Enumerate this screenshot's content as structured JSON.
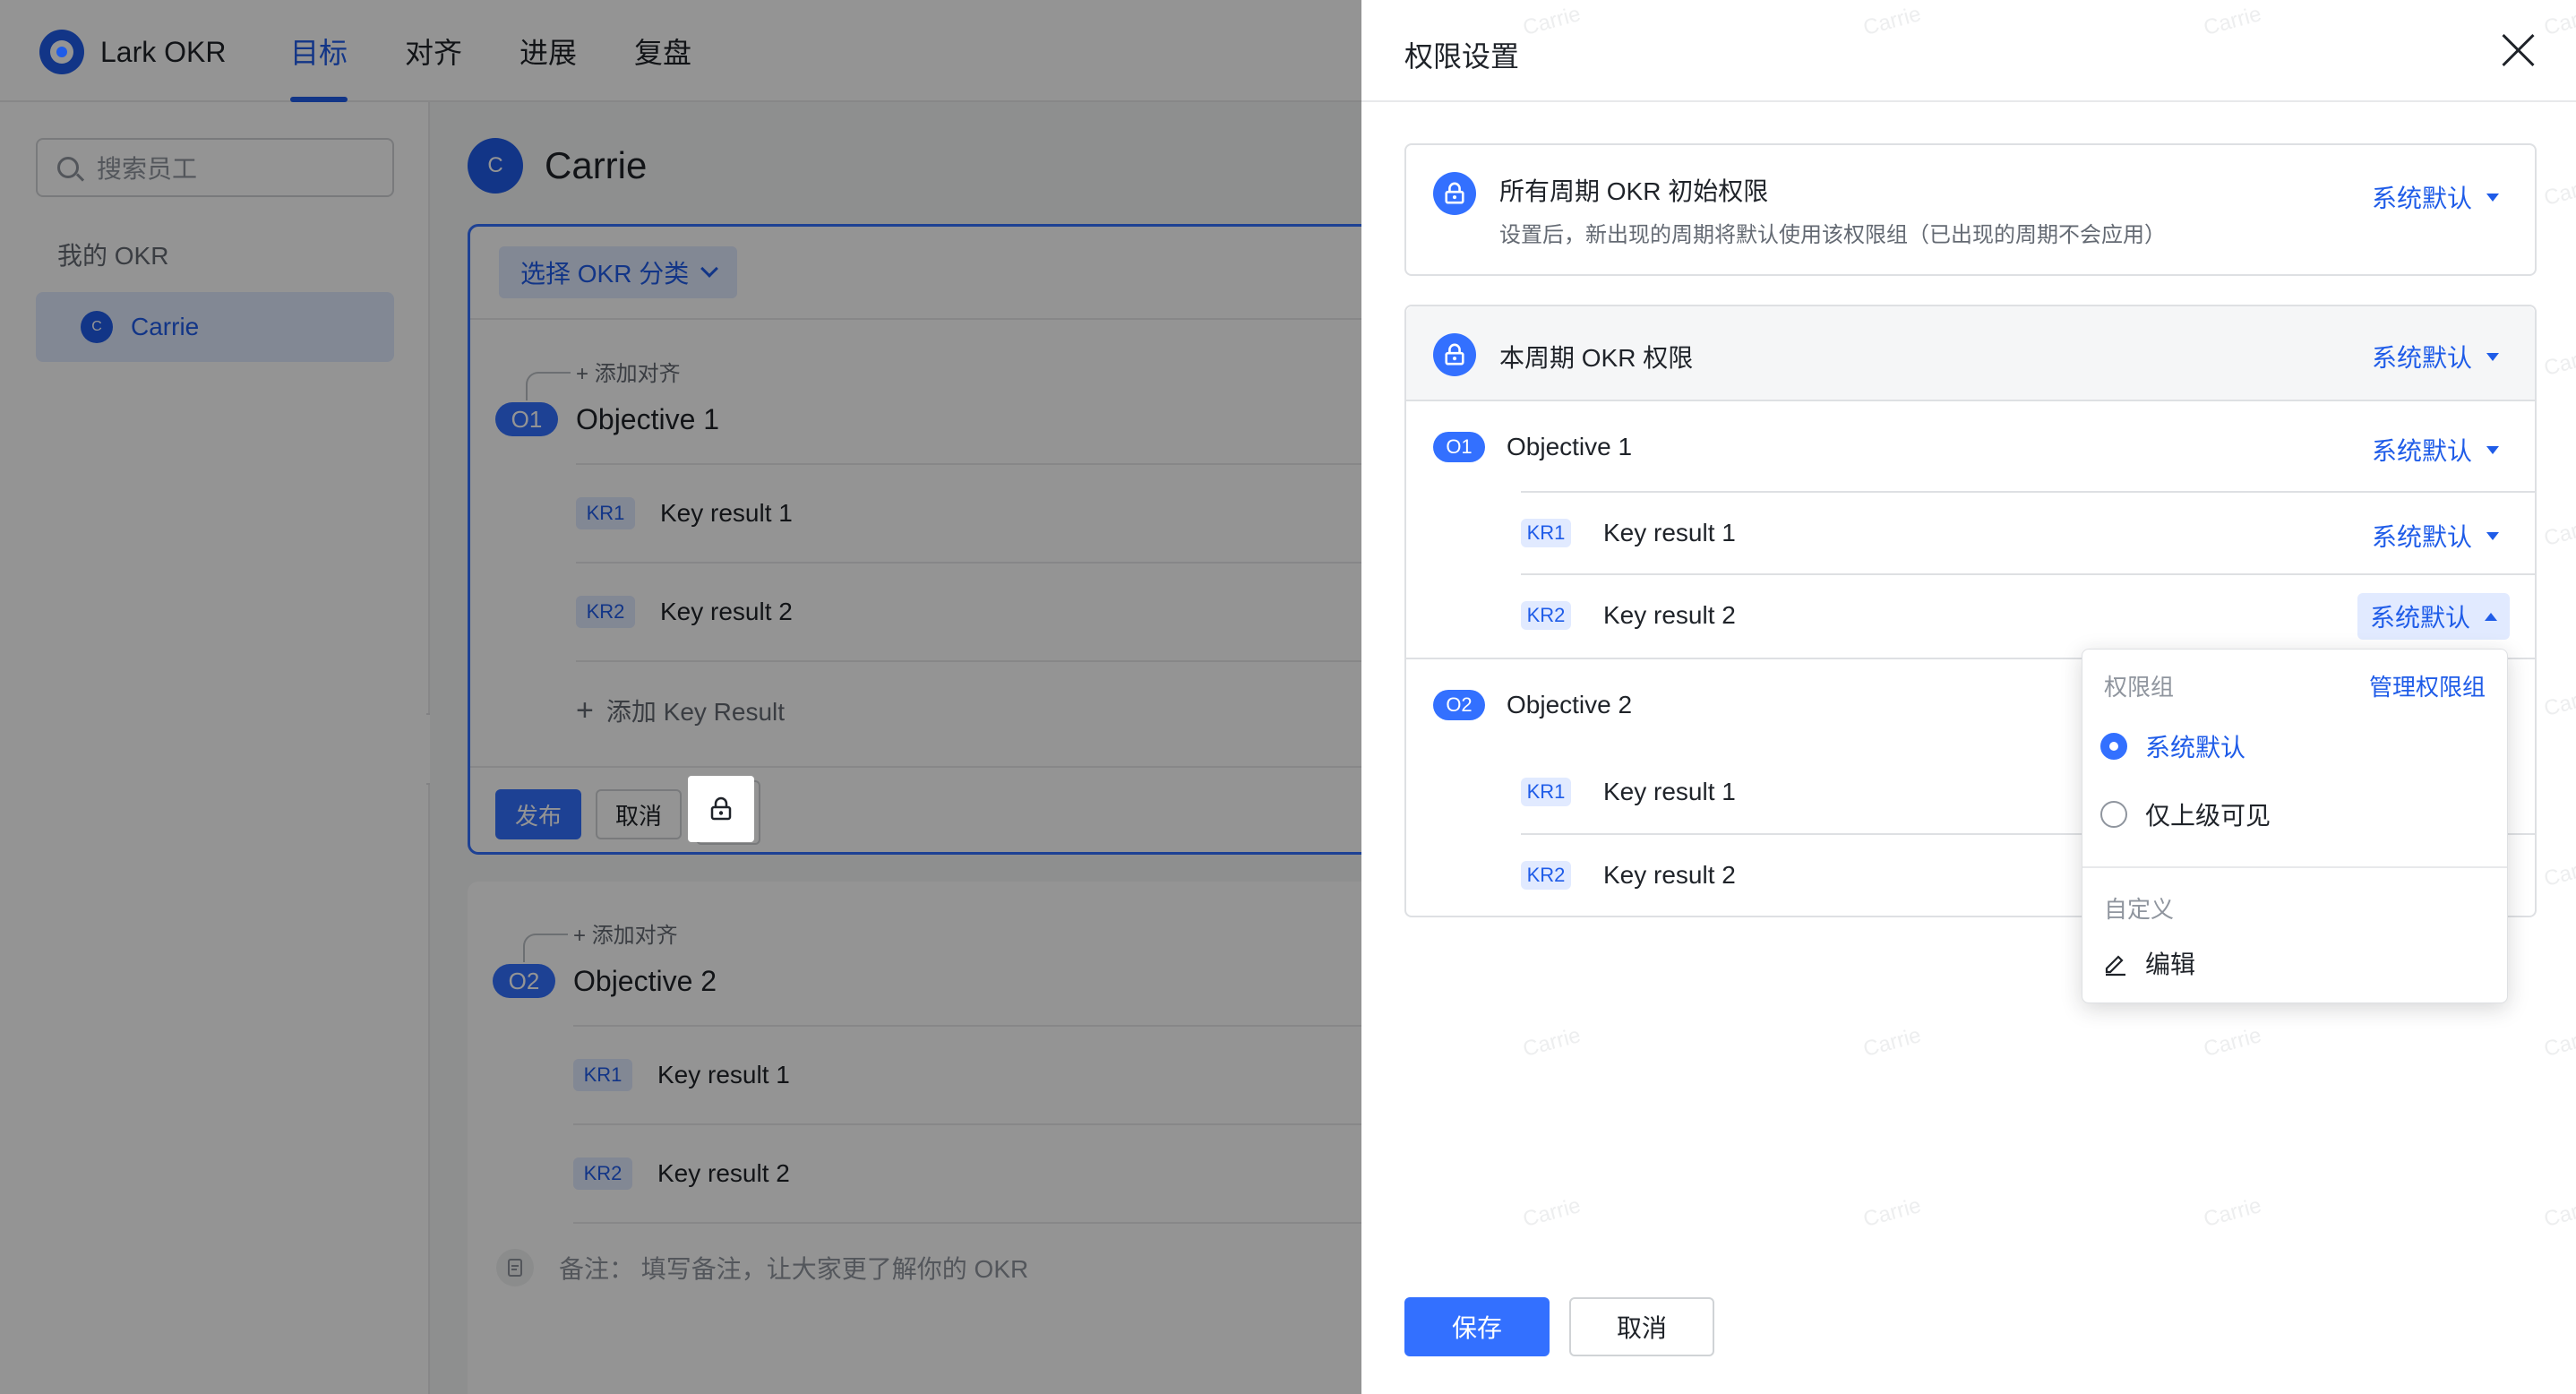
{
  "app": {
    "brand": "Lark OKR",
    "nav": [
      "目标",
      "对齐",
      "进展",
      "复盘"
    ],
    "active_nav": "目标"
  },
  "sidebar": {
    "search_placeholder": "搜索员工",
    "section_label": "我的 OKR",
    "user": {
      "initial": "C",
      "name": "Carrie"
    }
  },
  "main": {
    "owner": {
      "initial": "C",
      "name": "Carrie"
    },
    "category_select": "选择 OKR 分类",
    "objectives": [
      {
        "add_align": "添加对齐",
        "badge": "O1",
        "title": "Objective 1",
        "krs": [
          {
            "badge": "KR1",
            "title": "Key result 1"
          },
          {
            "badge": "KR2",
            "title": "Key result 2"
          }
        ],
        "add_kr": "添加 Key Result"
      },
      {
        "add_align": "添加对齐",
        "badge": "O2",
        "title": "Objective 2",
        "krs": [
          {
            "badge": "KR1",
            "title": "Key result 1"
          },
          {
            "badge": "KR2",
            "title": "Key result 2"
          }
        ]
      }
    ],
    "publish": "发布",
    "cancel": "取消",
    "note": "备注：  填写备注，让大家更了解你的 OKR"
  },
  "drawer": {
    "title": "权限设置",
    "all_period": {
      "title": "所有周期 OKR 初始权限",
      "desc": "设置后，新出现的周期将默认使用该权限组（已出现的周期不会应用）",
      "value": "系统默认"
    },
    "current_period": {
      "title": "本周期 OKR 权限",
      "value": "系统默认",
      "objectives": [
        {
          "badge": "O1",
          "title": "Objective 1",
          "value": "系统默认",
          "krs": [
            {
              "badge": "KR1",
              "title": "Key result 1",
              "value": "系统默认"
            },
            {
              "badge": "KR2",
              "title": "Key result 2",
              "value": "系统默认"
            }
          ]
        },
        {
          "badge": "O2",
          "title": "Objective 2",
          "krs": [
            {
              "badge": "KR1",
              "title": "Key result 1"
            },
            {
              "badge": "KR2",
              "title": "Key result 2"
            }
          ]
        }
      ]
    },
    "dropdown": {
      "group_label": "权限组",
      "manage": "管理权限组",
      "options": [
        "系统默认",
        "仅上级可见"
      ],
      "selected": "系统默认",
      "custom_label": "自定义",
      "edit": "编辑"
    },
    "save": "保存",
    "cancel": "取消",
    "watermark": "Carrie"
  },
  "colors": {
    "accent": "#3370ff",
    "accent_text": "#1f5ce8",
    "accent_light": "#e1eaff"
  }
}
